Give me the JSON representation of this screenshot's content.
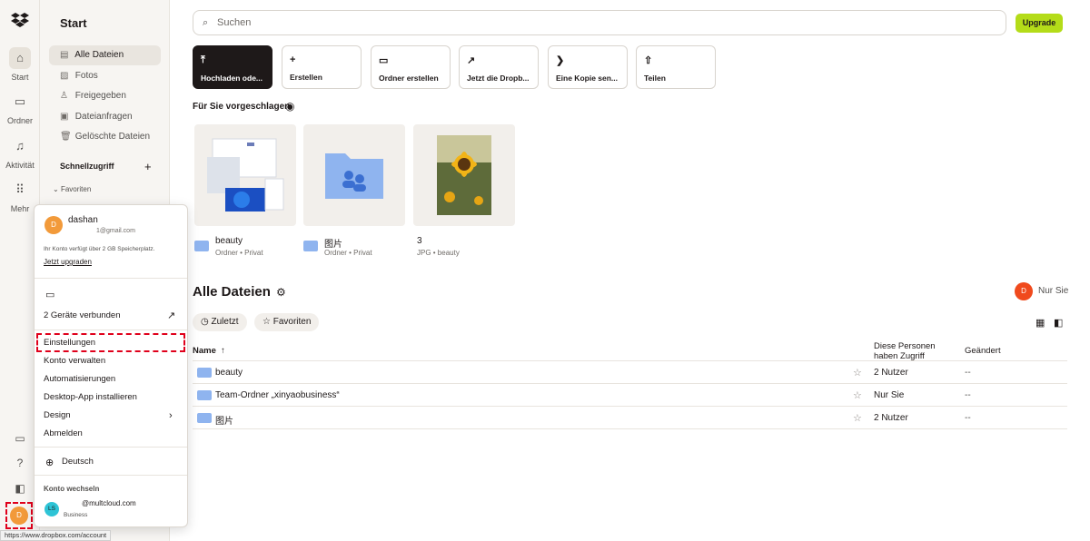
{
  "rail": {
    "items": [
      {
        "label": "Start"
      },
      {
        "label": "Ordner"
      },
      {
        "label": "Aktivität"
      },
      {
        "label": "Mehr"
      }
    ],
    "avatar_initial": "D"
  },
  "sidebar": {
    "title": "Start",
    "items": [
      {
        "label": "Alle Dateien"
      },
      {
        "label": "Fotos"
      },
      {
        "label": "Freigegeben"
      },
      {
        "label": "Dateianfragen"
      },
      {
        "label": "Gelöschte Dateien"
      }
    ],
    "quick_access": "Schnellzugriff",
    "favorites": "Favoriten"
  },
  "search": {
    "placeholder": "Suchen"
  },
  "upgrade_label": "Upgrade",
  "actions": [
    {
      "label": "Hochladen ode..."
    },
    {
      "label": "Erstellen"
    },
    {
      "label": "Ordner erstellen"
    },
    {
      "label": "Jetzt die Dropb..."
    },
    {
      "label": "Eine Kopie sen..."
    },
    {
      "label": "Teilen"
    }
  ],
  "suggested": {
    "title": "Für Sie vorgeschlagen",
    "cards": [
      {
        "name": "beauty",
        "meta": "Ordner • Privat"
      },
      {
        "name": "图片",
        "meta": "Ordner • Privat"
      },
      {
        "name": "3",
        "meta": "JPG • beauty"
      }
    ]
  },
  "files": {
    "title": "Alle Dateien",
    "owner_initial": "D",
    "owner_label": "Nur Sie",
    "filters": [
      {
        "label": "Zuletzt"
      },
      {
        "label": "Favoriten"
      }
    ],
    "columns": {
      "name": "Name",
      "access": "Diese Personen haben Zugriff",
      "modified": "Geändert"
    },
    "rows": [
      {
        "name": "beauty",
        "access": "2 Nutzer",
        "modified": "--"
      },
      {
        "name": "Team-Ordner „xinyaobusiness“",
        "access": "Nur Sie",
        "modified": "--"
      },
      {
        "name": "图片",
        "access": "2 Nutzer",
        "modified": "--"
      }
    ]
  },
  "popover": {
    "avatar_initial": "D",
    "user_name": "dashan",
    "email": "1@gmail.com",
    "storage": "Ihr Konto verfügt über 2 GB Speicherplatz.",
    "upgrade_link": "Jetzt upgraden",
    "devices": "2 Geräte verbunden",
    "menu": [
      {
        "label": "Einstellungen"
      },
      {
        "label": "Konto verwalten"
      },
      {
        "label": "Automatisierungen"
      },
      {
        "label": "Desktop-App installieren"
      },
      {
        "label": "Design"
      },
      {
        "label": "Abmelden"
      }
    ],
    "language": "Deutsch",
    "switch_title": "Konto wechseln",
    "other_account": {
      "initials": "LS",
      "email": "@multcloud.com",
      "type": "Business"
    }
  },
  "status_url": "https://www.dropbox.com/account"
}
